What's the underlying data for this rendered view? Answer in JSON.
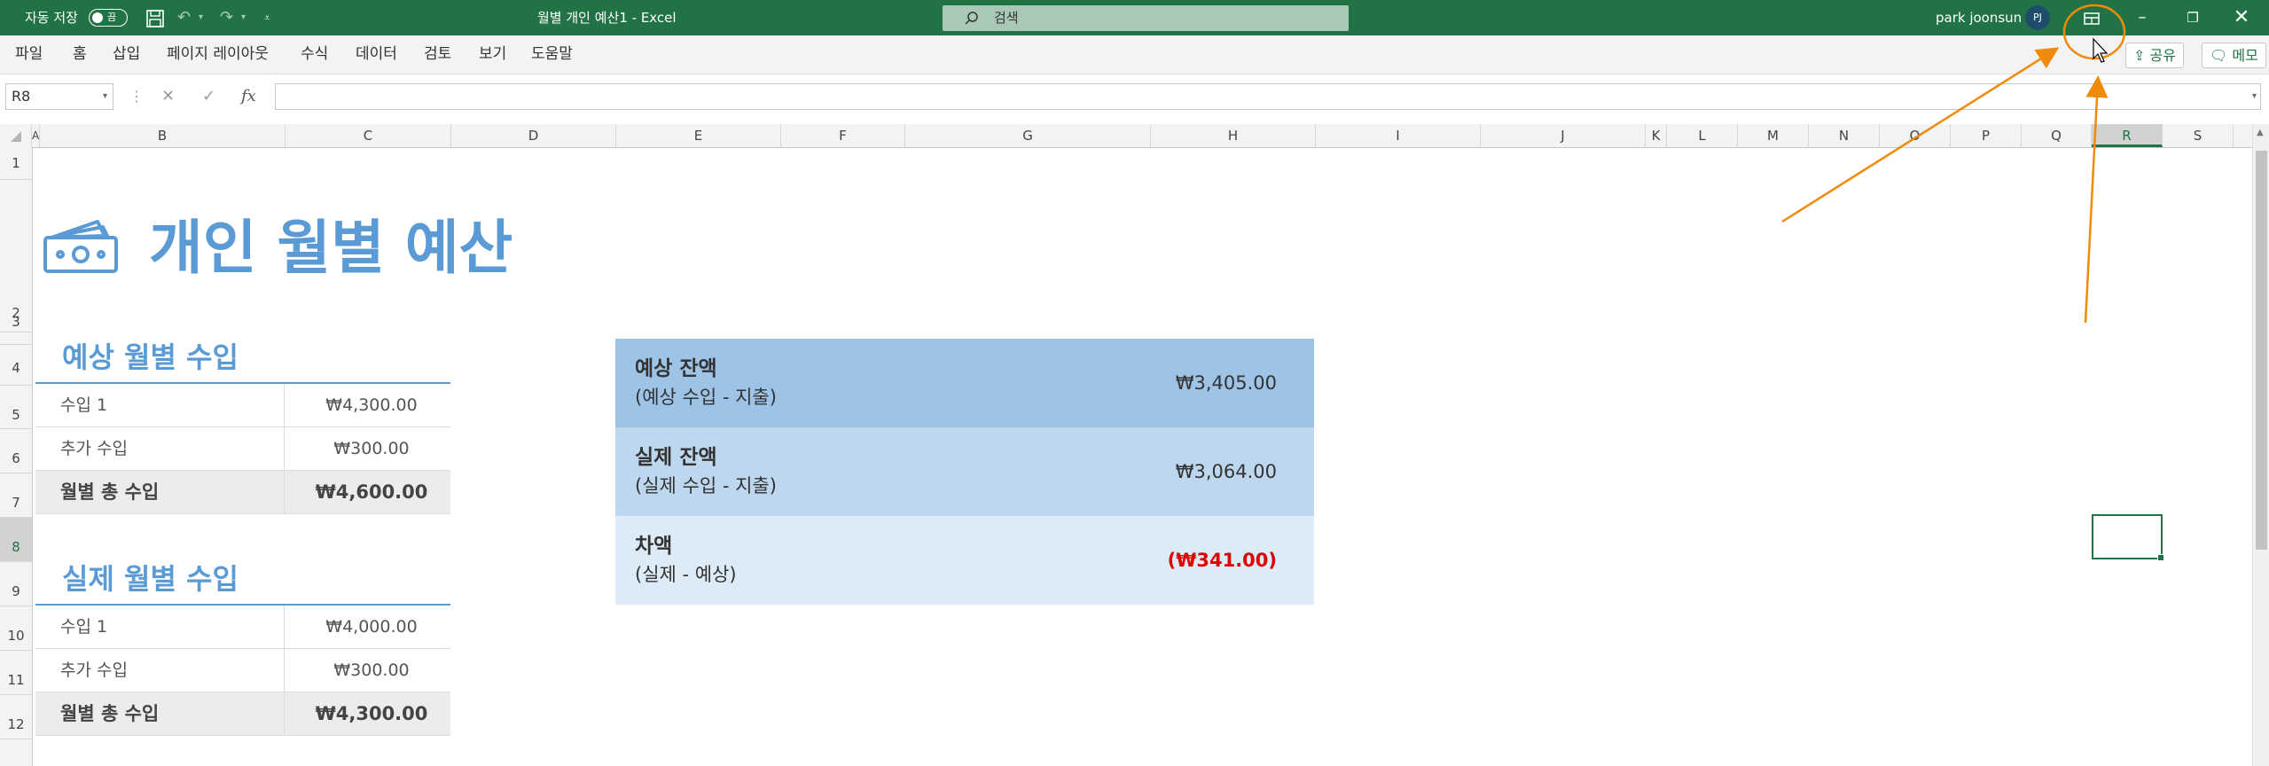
{
  "titlebar": {
    "autosave_label": "자동 저장",
    "autosave_state": "끔",
    "doc_title": "월별 개인 예산1  -  Excel",
    "search_placeholder": "검색",
    "user_name": "park joonsun",
    "user_initials": "PJ"
  },
  "menu": {
    "items": [
      "파일",
      "홈",
      "삽입",
      "페이지 레이아웃",
      "수식",
      "데이터",
      "검토",
      "보기",
      "도움말"
    ],
    "share_label": "공유",
    "memo_label": "메모"
  },
  "formula": {
    "name_box": "R8",
    "fx": "fx",
    "value": ""
  },
  "columns": [
    "A",
    "B",
    "C",
    "D",
    "E",
    "F",
    "G",
    "H",
    "I",
    "J",
    "K",
    "L",
    "M",
    "N",
    "O",
    "P",
    "Q",
    "R",
    "S"
  ],
  "selected_column": "R",
  "rows": [
    "1",
    "2",
    "3",
    "4",
    "5",
    "6",
    "7",
    "8",
    "9",
    "10",
    "11",
    "12"
  ],
  "selected_row": "8",
  "sheet": {
    "title": "개인 월별 예산",
    "projected": {
      "heading": "예상 월별 수입",
      "rows": [
        {
          "label": "수입 1",
          "value": "₩4,300.00"
        },
        {
          "label": "추가 수입",
          "value": "₩300.00"
        }
      ],
      "total": {
        "label": "월별 총 수입",
        "value": "₩4,600.00"
      }
    },
    "actual": {
      "heading": "실제 월별 수입",
      "rows": [
        {
          "label": "수입 1",
          "value": "₩4,000.00"
        },
        {
          "label": "추가 수입",
          "value": "₩300.00"
        }
      ],
      "total": {
        "label": "월별 총 수입",
        "value": "₩4,300.00"
      }
    },
    "balances": [
      {
        "title": "예상 잔액",
        "sub": "(예상 수입 - 지출)",
        "amount": "₩3,405.00",
        "color": "#9dc3e6"
      },
      {
        "title": "실제 잔액",
        "sub": "(실제 수입 - 지출)",
        "amount": "₩3,064.00",
        "color": "#bdd7ee"
      },
      {
        "title": "차액",
        "sub": "(실제 - 예상)",
        "amount": "(₩341.00)",
        "color": "#ddebf7",
        "amount_color": "#e00000"
      }
    ]
  },
  "colors": {
    "excel_green": "#217346",
    "accent_blue": "#5b9bd5",
    "annotation_orange": "#f08a0a"
  }
}
